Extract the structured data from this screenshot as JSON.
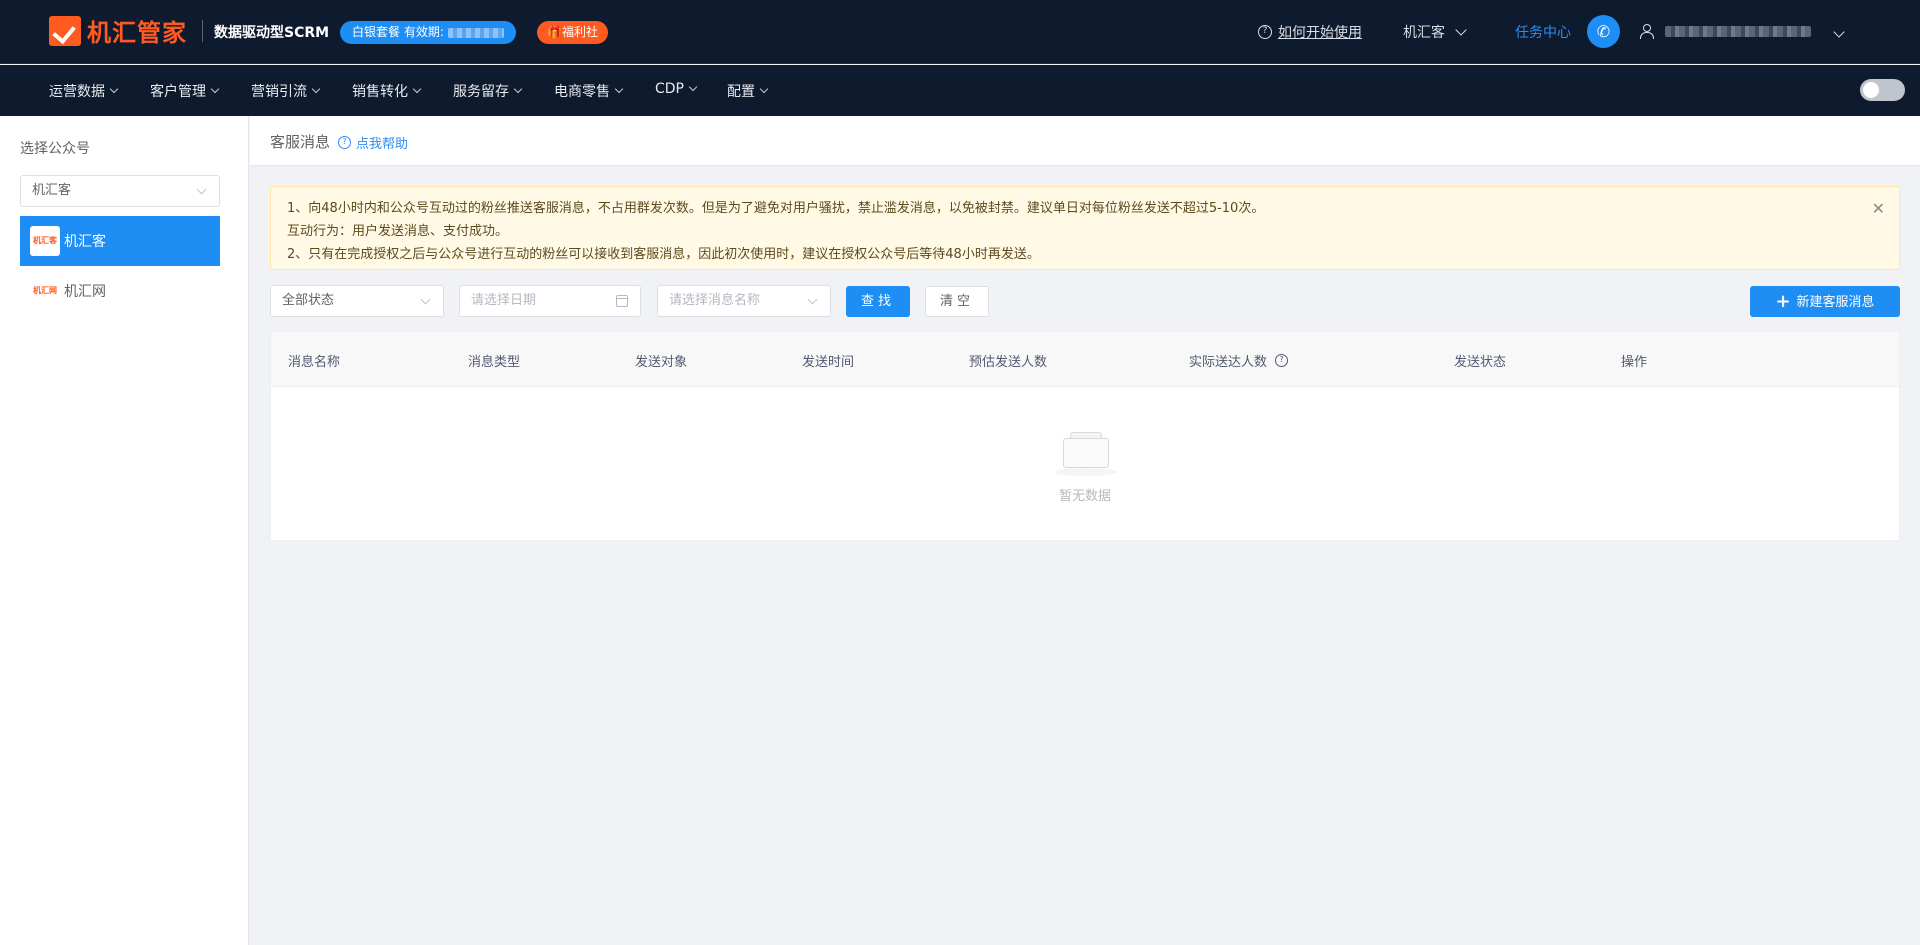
{
  "header": {
    "logo_text": "机汇管家",
    "slogan": "数据驱动型SCRM",
    "package_badge": "白银套餐 有效期:",
    "welfare_badge": "🎁福利社",
    "help_link": "如何开始使用",
    "account_switch": "机汇客",
    "task_center": "任务中心"
  },
  "nav": {
    "items": [
      "运营数据",
      "客户管理",
      "营销引流",
      "销售转化",
      "服务留存",
      "电商零售",
      "CDP",
      "配置"
    ]
  },
  "sidebar": {
    "title": "选择公众号",
    "select_value": "机汇客",
    "accounts": [
      {
        "avatar_text": "机汇客",
        "name": "机汇客"
      },
      {
        "avatar_text": "机汇网",
        "name": "机汇网"
      }
    ]
  },
  "breadcrumb": {
    "title": "客服消息",
    "help": "点我帮助"
  },
  "notice": {
    "line1": "1、向48小时内和公众号互动过的粉丝推送客服消息，不占用群发次数。但是为了避免对用户骚扰，禁止滥发消息，以免被封禁。建议单日对每位粉丝发送不超过5-10次。",
    "line2": "互动行为：用户发送消息、支付成功。",
    "line3": "2、只有在完成授权之后与公众号进行互动的粉丝可以接收到客服消息，因此初次使用时，建议在授权公众号后等待48小时再发送。"
  },
  "filters": {
    "status_value": "全部状态",
    "date_placeholder": "请选择日期",
    "name_placeholder": "请选择消息名称",
    "search_label": "查找",
    "clear_label": "清空",
    "new_label": "新建客服消息"
  },
  "table": {
    "columns": [
      "消息名称",
      "消息类型",
      "发送对象",
      "发送时间",
      "预估发送人数",
      "实际送达人数",
      "发送状态",
      "操作"
    ],
    "rows": [],
    "empty_text": "暂无数据"
  },
  "colors": {
    "primary": "#1e8ef5",
    "brand_orange": "#ff5a1f",
    "header_bg": "#0e1a2d"
  }
}
